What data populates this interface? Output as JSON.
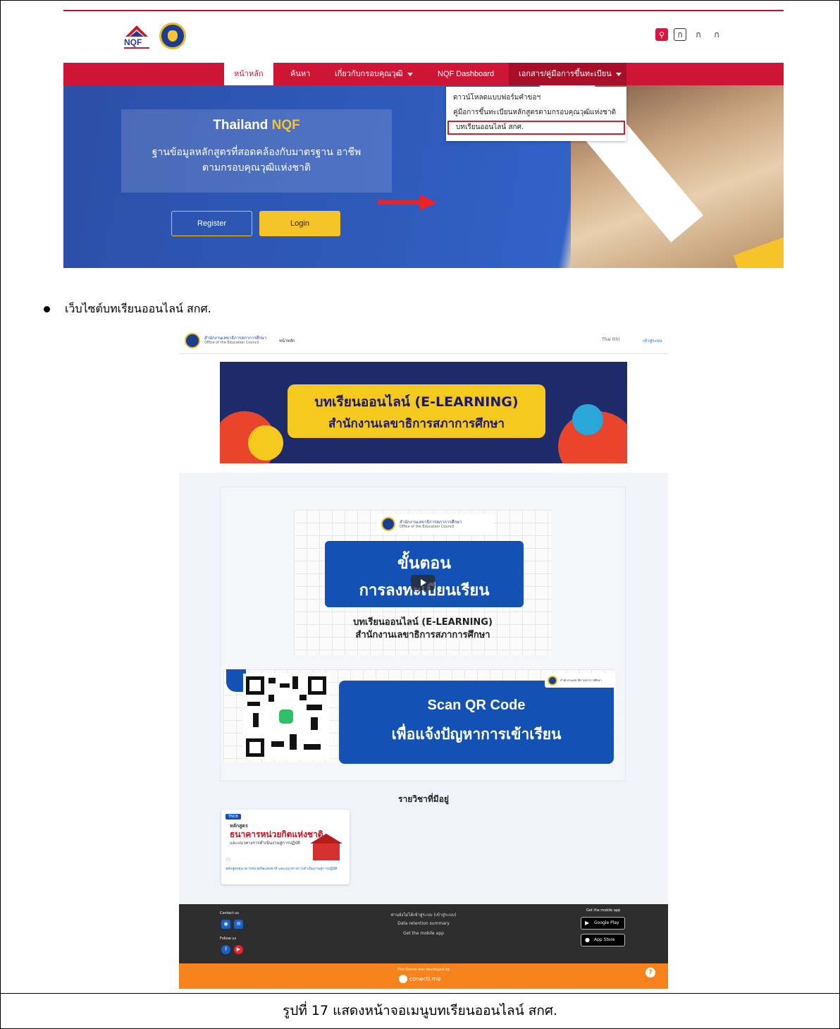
{
  "nqf": {
    "tools": [
      "ก",
      "ก",
      "ก"
    ],
    "nav": [
      "หน้าหลัก",
      "ค้นหา",
      "เกี่ยวกับกรอบคุณวุฒิ",
      "NQF Dashboard",
      "เอกสาร/คู่มือการขึ้นทะเบียน"
    ],
    "dropdown": [
      "ดาวน์โหลดแบบฟอร์มคำขอฯ",
      "คู่มือการขึ้นทะเบียนหลักสูตรตามกรอบคุณวุฒิแห่งชาติ",
      "บทเรียนออนไลน์ สกศ."
    ],
    "hero": {
      "title_main": "Thailand",
      "title_accent": "NQF",
      "subtitle_l1": "ฐานข้อมูลหลักสูตรที่สอดคล้องกับมาตรฐาน อาชีพ",
      "subtitle_l2": "ตามกรอบคุณวุฒิแห่งชาติ",
      "register": "Register",
      "login": "Login"
    }
  },
  "bullet": "เว็บไซต์บทเรียนออนไลน์ สกศ.",
  "elearn": {
    "org_th": "สำนักงานเลขาธิการสภาการศึกษา",
    "org_en": "Office of the Education Council",
    "home": "หน้าหลัก",
    "lang": "Thai (th)",
    "login": "เข้าสู่ระบบ",
    "banner_l1": "บทเรียนออนไลน์ (E-LEARNING)",
    "banner_l2": "สำนักงานเลขาธิการสภาการศึกษา",
    "video_step_l1": "ขั้นตอน",
    "video_step_l2": "การลงทะเบียนเรียน",
    "video_t1": "บทเรียนออนไลน์ (E-LEARNING)",
    "video_t2": "สำนักงานเลขาธิการสภาการศึกษา",
    "qr_l1": "Scan QR Code",
    "qr_l2": "เพื่อแจ้งปัญหาการเข้าเรียน",
    "courses_heading": "รายวิชาที่มีอยู่",
    "course": {
      "badge": "TNCB",
      "k1": "หลักสูตร",
      "k2": "ธนาคารหน่วยกิตแห่งชาติ",
      "k3": "และแนวทางการดำเนินงานสู่การปฏิบัติ",
      "dots": ":::",
      "link": "หลักสูตรธนาคารหน่วยกิตแห่งชาติ และแนวทางการดำเนินงานสู่การปฏิบัติ"
    },
    "footer": {
      "contact": "Contact us",
      "follow": "Follow us",
      "links": [
        "ท่านยังไม่ได้เข้าสู่ระบบ (เข้าสู่ระบบ)",
        "Data retention summary",
        "Get the mobile app"
      ],
      "mobile_heading": "Get the mobile app",
      "google_play": "Google Play",
      "app_store": "App Store"
    },
    "bottom_by": "This theme was developed by",
    "bottom_brand": "conecti.me",
    "help": "?"
  },
  "caption": "รูปที่ 17 แสดงหน้าจอเมนูบทเรียนออนไลน์ สกศ."
}
